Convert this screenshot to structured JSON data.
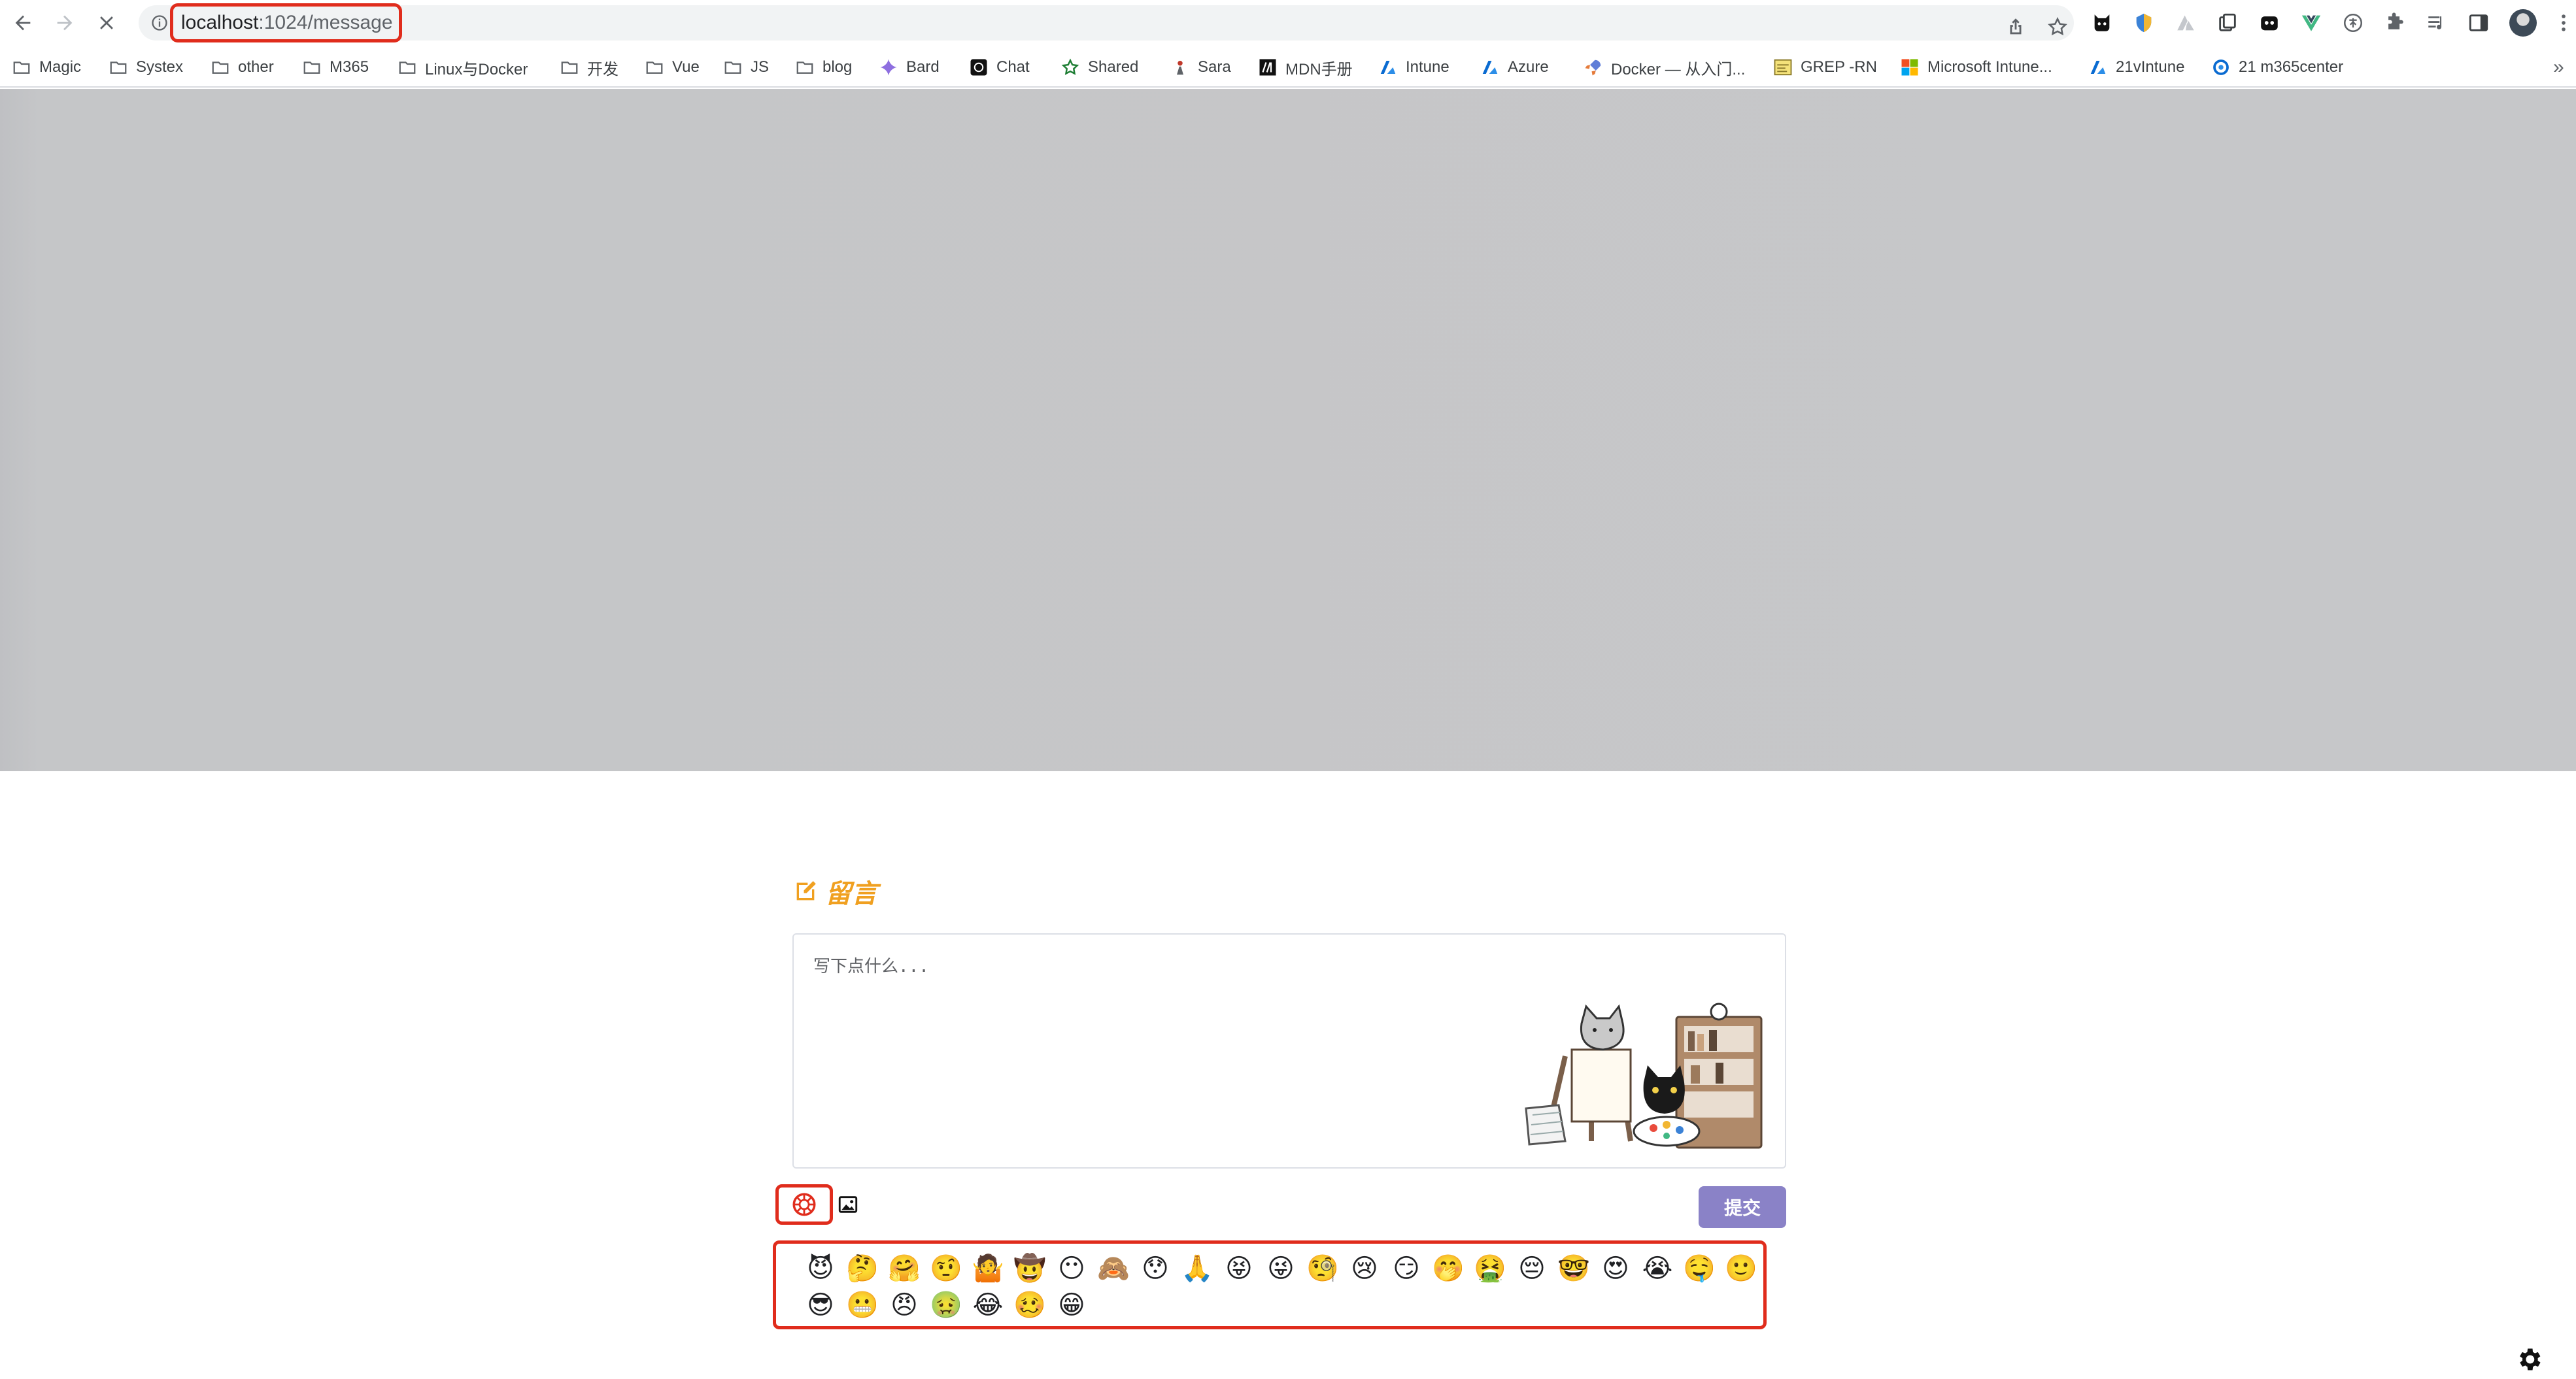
{
  "browser": {
    "url_host": "localhost",
    "url_path": ":1024/message",
    "bookmarks": [
      {
        "label": "Magic",
        "icon": "folder-icon"
      },
      {
        "label": "Systex",
        "icon": "folder-icon"
      },
      {
        "label": "other",
        "icon": "folder-icon"
      },
      {
        "label": "M365",
        "icon": "folder-icon"
      },
      {
        "label": "Linux与Docker",
        "icon": "folder-icon"
      },
      {
        "label": "开发",
        "icon": "folder-icon"
      },
      {
        "label": "Vue",
        "icon": "folder-icon"
      },
      {
        "label": "JS",
        "icon": "folder-icon"
      },
      {
        "label": "blog",
        "icon": "folder-icon"
      },
      {
        "label": "Bard",
        "icon": "bard-icon"
      },
      {
        "label": "Chat",
        "icon": "chatgpt-icon"
      },
      {
        "label": "Shared",
        "icon": "star-icon"
      },
      {
        "label": "Sara",
        "icon": "sara-icon"
      },
      {
        "label": "MDN手册",
        "icon": "mdn-icon"
      },
      {
        "label": "Intune",
        "icon": "azure-icon"
      },
      {
        "label": "Azure",
        "icon": "azure-icon"
      },
      {
        "label": "Docker — 从入门...",
        "icon": "rocket-icon"
      },
      {
        "label": "GREP -RN",
        "icon": "grep-icon"
      },
      {
        "label": "Microsoft Intune...",
        "icon": "microsoft-icon"
      },
      {
        "label": "21vIntune",
        "icon": "azure-icon"
      },
      {
        "label": "21 m365center",
        "icon": "m365-icon"
      }
    ]
  },
  "page": {
    "title": "留言",
    "editor_placeholder": "写下点什么...",
    "submit_label": "提交",
    "emojis": [
      "😈",
      "🤔",
      "🤗",
      "🤨",
      "🤷",
      "🤠",
      "😶",
      "🙈",
      "😯",
      "🙏",
      "😝",
      "😜",
      "🧐",
      "😢",
      "😏",
      "🤭",
      "🤮",
      "😔",
      "🤓",
      "😍",
      "😭",
      "🤤",
      "🙂",
      "😎",
      "😬",
      "😠",
      "🤢",
      "😂",
      "🥴",
      "😁"
    ]
  },
  "colors": {
    "accent_orange": "#f0a020",
    "submit_purple": "#8a82c7",
    "highlight_red": "#e02c1c",
    "banner_gray": "#c6c7c9"
  }
}
